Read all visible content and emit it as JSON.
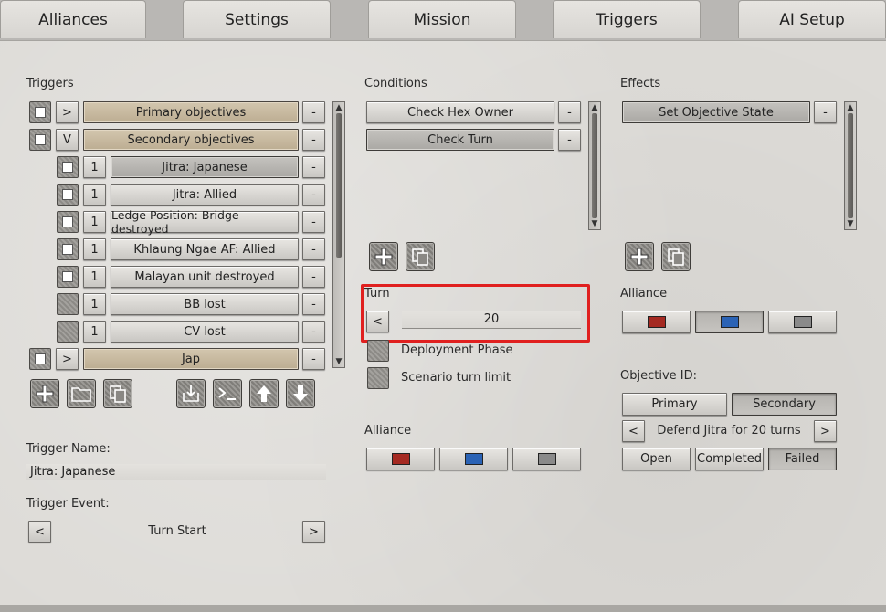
{
  "tabs": [
    "Alliances",
    "Settings",
    "Mission",
    "Triggers",
    "AI Setup"
  ],
  "triggers": {
    "title": "Triggers",
    "rows": [
      {
        "toggle": ">",
        "label": "Primary objectives",
        "remove": "-"
      },
      {
        "toggle": "V",
        "label": "Secondary objectives",
        "remove": "-"
      },
      {
        "num": "1",
        "label": "Jitra: Japanese",
        "remove": "-"
      },
      {
        "num": "1",
        "label": "Jitra: Allied",
        "remove": "-"
      },
      {
        "num": "1",
        "label": "Ledge Position: Bridge destroyed",
        "remove": "-"
      },
      {
        "num": "1",
        "label": "Khlaung Ngae AF: Allied",
        "remove": "-"
      },
      {
        "num": "1",
        "label": "Malayan unit destroyed",
        "remove": "-"
      },
      {
        "num": "1",
        "label": "BB lost",
        "remove": "-"
      },
      {
        "num": "1",
        "label": "CV lost",
        "remove": "-"
      },
      {
        "toggle": ">",
        "label": "Jap",
        "remove": "-"
      }
    ],
    "trigger_name_label": "Trigger Name:",
    "trigger_name_value": "Jitra: Japanese",
    "trigger_event_label": "Trigger Event:",
    "trigger_event_prev": "<",
    "trigger_event_value": "Turn Start",
    "trigger_event_next": ">"
  },
  "conditions": {
    "title": "Conditions",
    "items": [
      {
        "label": "Check Hex Owner",
        "remove": "-"
      },
      {
        "label": "Check Turn",
        "remove": "-"
      }
    ],
    "turn_label": "Turn",
    "turn_prev": "<",
    "turn_value": "20",
    "deployment_phase": "Deployment Phase",
    "scenario_turn_limit": "Scenario turn limit",
    "alliance_label": "Alliance"
  },
  "effects": {
    "title": "Effects",
    "items": [
      {
        "label": "Set Objective State",
        "remove": "-"
      }
    ],
    "alliance_label": "Alliance",
    "objective_id_label": "Objective ID:",
    "primary": "Primary",
    "secondary": "Secondary",
    "objective_prev": "<",
    "objective_value": "Defend Jitra for 20 turns",
    "objective_next": ">",
    "open": "Open",
    "completed": "Completed",
    "failed": "Failed"
  },
  "colors": {
    "red": "#a52a22",
    "blue": "#2b63b5",
    "gray": "#8a8a8a",
    "highlight": "#e0201f"
  }
}
